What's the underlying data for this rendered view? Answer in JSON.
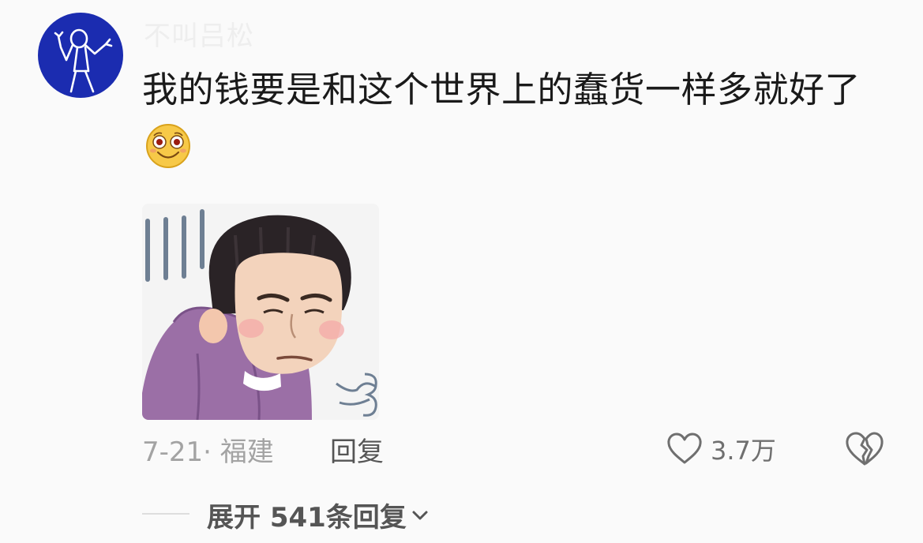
{
  "comment": {
    "username": "不叫吕松",
    "text": "我的钱要是和这个世界上的蠢货一样多就好了",
    "emoji_icon": "grinning-emoji-icon",
    "sticker_icon": "sighing-person-sticker",
    "meta": "7-21· 福建",
    "reply_label": "回复",
    "like_count": "3.7万",
    "expand_label": "展开 541条回复"
  },
  "colors": {
    "avatar_bg": "#1b2cb0",
    "text_primary": "#1a1a1a",
    "text_secondary": "#a3a3a3",
    "background": "#fafafa"
  }
}
